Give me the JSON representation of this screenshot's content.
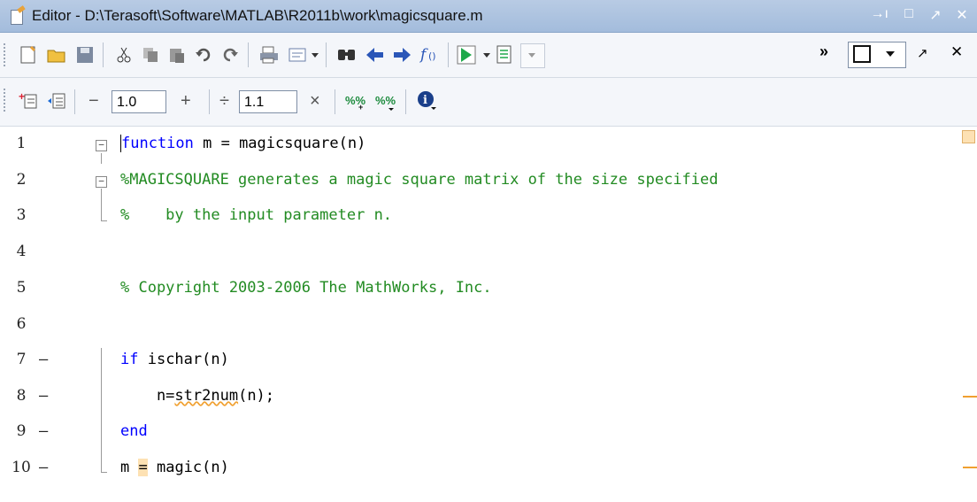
{
  "window": {
    "title": "Editor - D:\\Terasoft\\Software\\MATLAB\\R2011b\\work\\magicsquare.m",
    "controls": [
      "→ı",
      "□",
      "↗",
      "✕"
    ]
  },
  "toolbar1": {
    "icons": [
      "new-file-icon",
      "open-folder-icon",
      "save-icon",
      "cut-icon",
      "copy-icon",
      "paste-icon",
      "undo-icon",
      "redo-icon",
      "print-icon",
      "comment-icon",
      "find-icon",
      "back-icon",
      "forward-icon",
      "function-icon",
      "run-icon",
      "breakpoint-icon"
    ],
    "overflow": "»",
    "dock_controls": [
      "↗",
      "✕"
    ]
  },
  "toolbar2": {
    "minus": "−",
    "cell_dec_value": "1.0",
    "plus": "+",
    "divide": "÷",
    "cell_scale_value": "1.1",
    "times": "×"
  },
  "code": {
    "lines": [
      {
        "num": "1",
        "dash": "",
        "text": "function m = magicsquare(n)"
      },
      {
        "num": "2",
        "dash": "",
        "text": "%MAGICSQUARE generates a magic square matrix of the size specified"
      },
      {
        "num": "3",
        "dash": "",
        "text": "%    by the input parameter n."
      },
      {
        "num": "4",
        "dash": "",
        "text": ""
      },
      {
        "num": "5",
        "dash": "",
        "text": "% Copyright 2003-2006 The MathWorks, Inc."
      },
      {
        "num": "6",
        "dash": "",
        "text": ""
      },
      {
        "num": "7",
        "dash": "–",
        "text": "if ischar(n)"
      },
      {
        "num": "8",
        "dash": "–",
        "text": "    n=str2num(n);"
      },
      {
        "num": "9",
        "dash": "–",
        "text": "end"
      },
      {
        "num": "10",
        "dash": "–",
        "text": "m = magic(n)"
      }
    ]
  },
  "colors": {
    "keyword": "#0000ff",
    "comment": "#228b22",
    "warning": "#f0a030"
  }
}
